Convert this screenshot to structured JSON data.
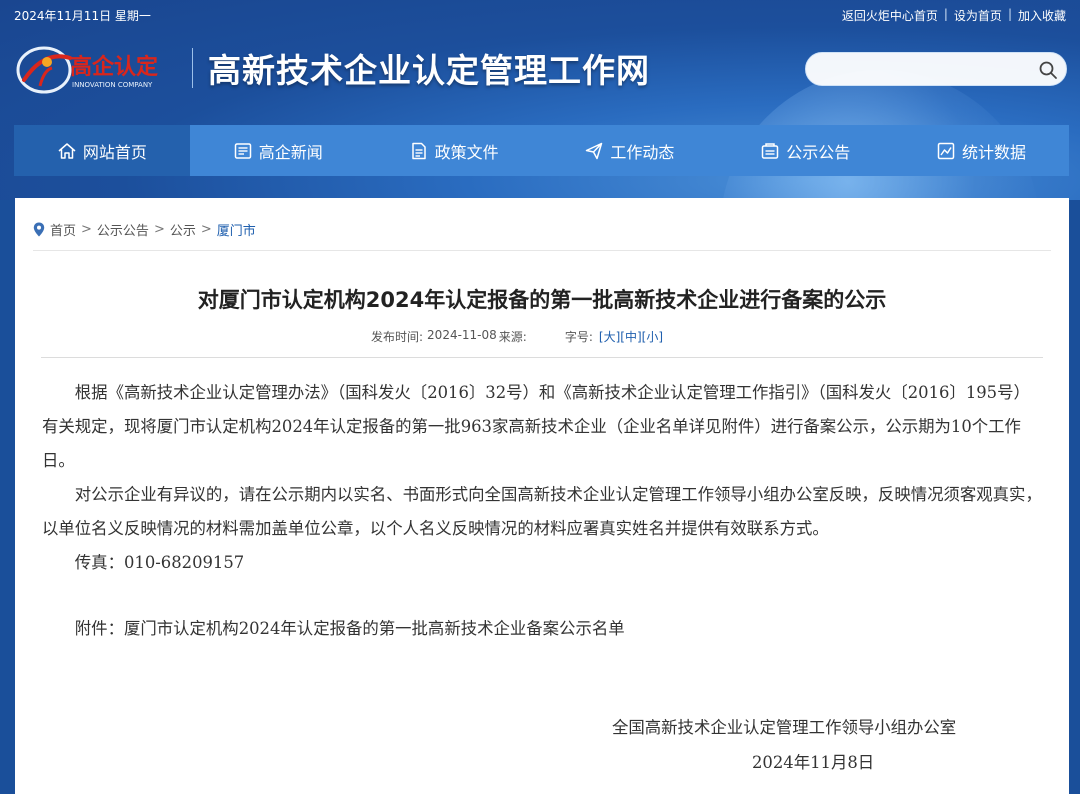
{
  "topbar": {
    "date": "2024年11月11日 星期一",
    "links": [
      "返回火炬中心首页",
      "设为首页",
      "加入收藏"
    ]
  },
  "logo": {
    "cn": "高企认定",
    "en": "INNOVATION COMPANY",
    "site_title": "高新技术企业认定管理工作网"
  },
  "search": {
    "placeholder": ""
  },
  "nav": [
    {
      "label": "网站首页",
      "icon": "home-icon"
    },
    {
      "label": "高企新闻",
      "icon": "news-icon"
    },
    {
      "label": "政策文件",
      "icon": "document-icon"
    },
    {
      "label": "工作动态",
      "icon": "send-icon"
    },
    {
      "label": "公示公告",
      "icon": "notice-icon"
    },
    {
      "label": "统计数据",
      "icon": "chart-icon"
    }
  ],
  "breadcrumb": [
    "首页",
    "公示公告",
    "公示",
    "厦门市"
  ],
  "article": {
    "title": "对厦门市认定机构2024年认定报备的第一批高新技术企业进行备案的公示",
    "meta": {
      "publish_label": "发布时间:",
      "publish_date": "2024-11-08",
      "source_label": "来源:",
      "font_label": "字号:",
      "font_sizes": [
        "[大]",
        "[中]",
        "[小]"
      ]
    },
    "paragraphs": [
      "根据《高新技术企业认定管理办法》（国科发火〔2016〕32号）和《高新技术企业认定管理工作指引》（国科发火〔2016〕195号）有关规定，现将厦门市认定机构2024年认定报备的第一批963家高新技术企业（企业名单详见附件）进行备案公示，公示期为10个工作日。",
      "对公示企业有异议的，请在公示期内以实名、书面形式向全国高新技术企业认定管理工作领导小组办公室反映，反映情况须客观真实，以单位名义反映情况的材料需加盖单位公章，以个人名义反映情况的材料应署真实姓名并提供有效联系方式。",
      "传真：010-68209157"
    ],
    "attachment": "附件：厦门市认定机构2024年认定报备的第一批高新技术企业备案公示名单",
    "signature": "全国高新技术企业认定管理工作领导小组办公室",
    "sign_date": "2024年11月8日"
  }
}
